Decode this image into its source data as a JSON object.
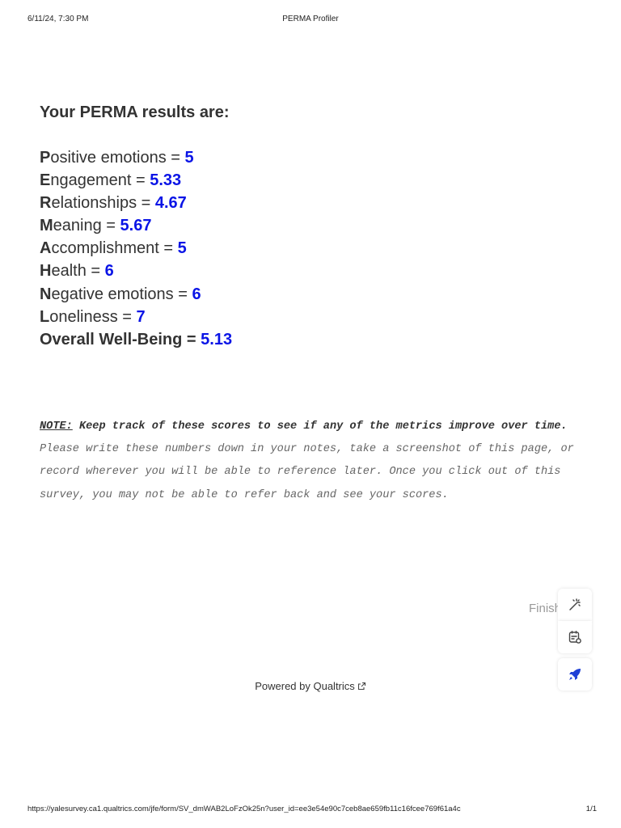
{
  "print_header": {
    "datetime": "6/11/24, 7:30 PM",
    "title": "PERMA Profiler"
  },
  "results": {
    "heading": "Your PERMA results are:",
    "metrics": [
      {
        "initial": "P",
        "rest": "ositive emotions",
        "value": "5"
      },
      {
        "initial": "E",
        "rest": "ngagement",
        "value": "5.33"
      },
      {
        "initial": "R",
        "rest": "elationships",
        "value": "4.67"
      },
      {
        "initial": "M",
        "rest": "eaning",
        "value": "5.67"
      },
      {
        "initial": "A",
        "rest": "ccomplishment",
        "value": "5"
      },
      {
        "initial": "H",
        "rest": "ealth",
        "value": "6"
      },
      {
        "initial": "N",
        "rest": "egative emotions",
        "value": "6"
      },
      {
        "initial": "L",
        "rest": "oneliness",
        "value": "7"
      },
      {
        "initial": "",
        "rest": "Overall Well-Being",
        "value": "5.13"
      }
    ],
    "equals": " = ",
    "value_color": "#0a14e6"
  },
  "note": {
    "label": "NOTE:",
    "strong": "Keep track of these scores to see if any of the metrics improve over time.",
    "body": "Please write these numbers down in your notes, take a screenshot of this page, or record wherever you will be able to reference later. Once you click out of this survey, you may not be able to refer back and see your scores."
  },
  "finish_button": {
    "label": "Finish"
  },
  "side_toolbar": {
    "icons": [
      "magic-wand-icon",
      "notes-sync-icon",
      "rocket-icon"
    ],
    "accent_color": "#1e3fd6"
  },
  "footer": {
    "powered_by": "Powered by Qualtrics",
    "icon": "external-link-icon"
  },
  "print_footer": {
    "url": "https://yalesurvey.ca1.qualtrics.com/jfe/form/SV_dmWAB2LoFzOk25n?user_id=ee3e54e90c7ceb8ae659fb11c16fcee769f61a4c",
    "page": "1/1"
  }
}
